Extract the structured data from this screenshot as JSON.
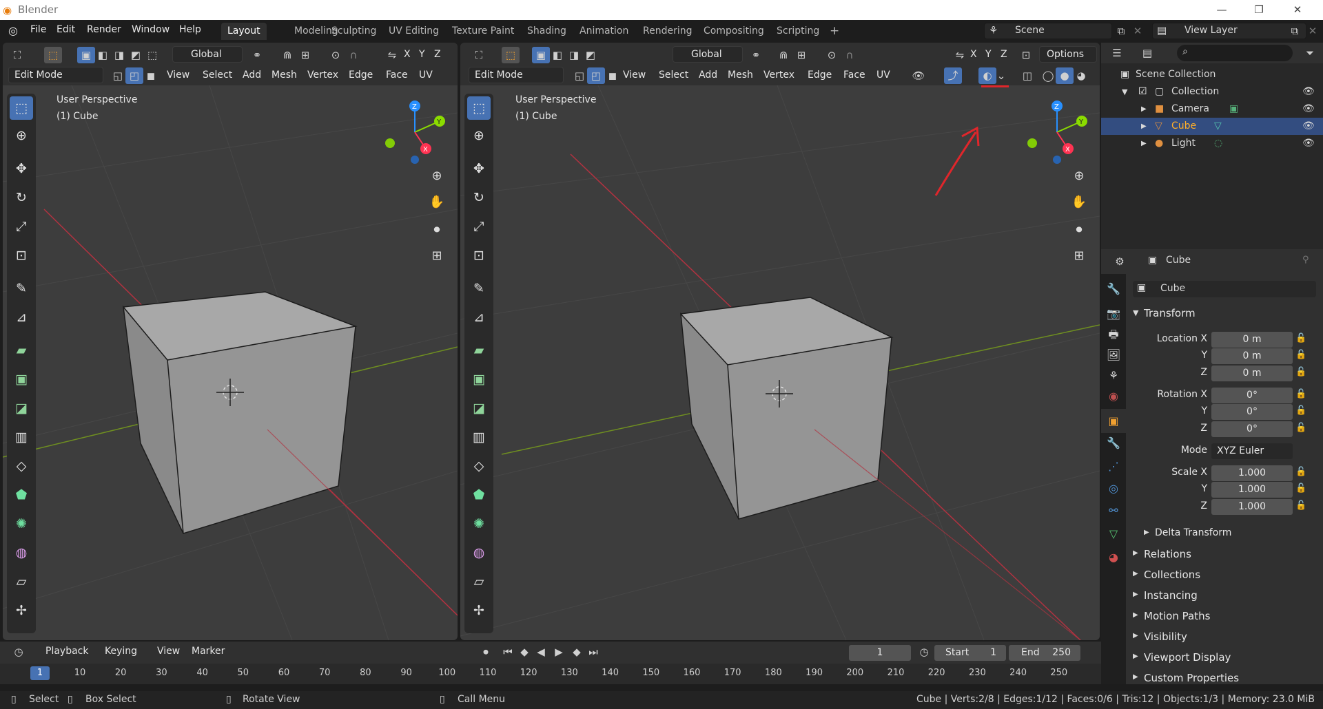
{
  "app": {
    "title": "Blender",
    "logo": "blender-logo-icon"
  },
  "window_controls": {
    "minimize": "—",
    "maximize": "❐",
    "close": "✕"
  },
  "menu": {
    "items": [
      "File",
      "Edit",
      "Render",
      "Window",
      "Help"
    ]
  },
  "workspaces": {
    "tabs": [
      "Layout",
      "Modeling",
      "Sculpting",
      "UV Editing",
      "Texture Paint",
      "Shading",
      "Animation",
      "Rendering",
      "Compositing",
      "Scripting",
      "+"
    ],
    "active": "Layout"
  },
  "scene": {
    "name": "Scene",
    "view_layer": "View Layer"
  },
  "viewport_left": {
    "transform": "Global",
    "mode": "Edit Mode",
    "menus": [
      "View",
      "Select",
      "Add",
      "Mesh",
      "Vertex",
      "Edge",
      "Face",
      "UV"
    ],
    "perspective": "User Perspective",
    "object": "(1) Cube"
  },
  "viewport_right": {
    "transform": "Global",
    "mode": "Edit Mode",
    "options": "Options",
    "menus": [
      "View",
      "Select",
      "Add",
      "Mesh",
      "Vertex",
      "Edge",
      "Face",
      "UV"
    ],
    "perspective": "User Perspective",
    "object": "(1) Cube"
  },
  "gizmo": {
    "x": "X",
    "y": "Y",
    "z": "Z"
  },
  "outliner": {
    "header": "Scene Collection",
    "items": [
      {
        "label": "Collection",
        "icon": "collection-icon"
      },
      {
        "label": "Camera",
        "icon": "camera-icon"
      },
      {
        "label": "Cube",
        "icon": "mesh-icon",
        "selected": true
      },
      {
        "label": "Light",
        "icon": "light-icon"
      }
    ]
  },
  "properties": {
    "object_name": "Cube",
    "data_name": "Cube",
    "transform_label": "Transform",
    "location": {
      "label": "Location X",
      "x": "0 m",
      "y": "0 m",
      "z": "0 m"
    },
    "rotation": {
      "label": "Rotation X",
      "x": "0°",
      "y": "0°",
      "z": "0°"
    },
    "mode": {
      "label": "Mode",
      "value": "XYZ Euler"
    },
    "scale": {
      "label": "Scale X",
      "x": "1.000",
      "y": "1.000",
      "z": "1.000"
    },
    "axis_y": "Y",
    "axis_z": "Z",
    "sections": [
      "Delta Transform",
      "Relations",
      "Collections",
      "Instancing",
      "Motion Paths",
      "Visibility",
      "Viewport Display",
      "Custom Properties"
    ]
  },
  "timeline": {
    "menus": [
      "Playback",
      "Keying",
      "View",
      "Marker"
    ],
    "current_frame": "1",
    "start_label": "Start",
    "start": "1",
    "end_label": "End",
    "end": "250",
    "ruler": [
      "1",
      "10",
      "20",
      "30",
      "40",
      "50",
      "60",
      "70",
      "80",
      "90",
      "100",
      "110",
      "120",
      "130",
      "140",
      "150",
      "160",
      "170",
      "180",
      "190",
      "200",
      "210",
      "220",
      "230",
      "240",
      "250"
    ]
  },
  "statusbar": {
    "select": "Select",
    "box_select": "Box Select",
    "rotate_view": "Rotate View",
    "call_menu": "Call Menu",
    "stats": "Cube | Verts:2/8 | Edges:1/12 | Faces:0/6 | Tris:12 | Objects:1/3 | Memory: 23.0 MiB"
  },
  "colors": {
    "accent": "#4772b3",
    "annotation": "#e0262b",
    "x_axis": "#ff3352",
    "y_axis": "#8bdc00",
    "z_axis": "#2890ff"
  }
}
